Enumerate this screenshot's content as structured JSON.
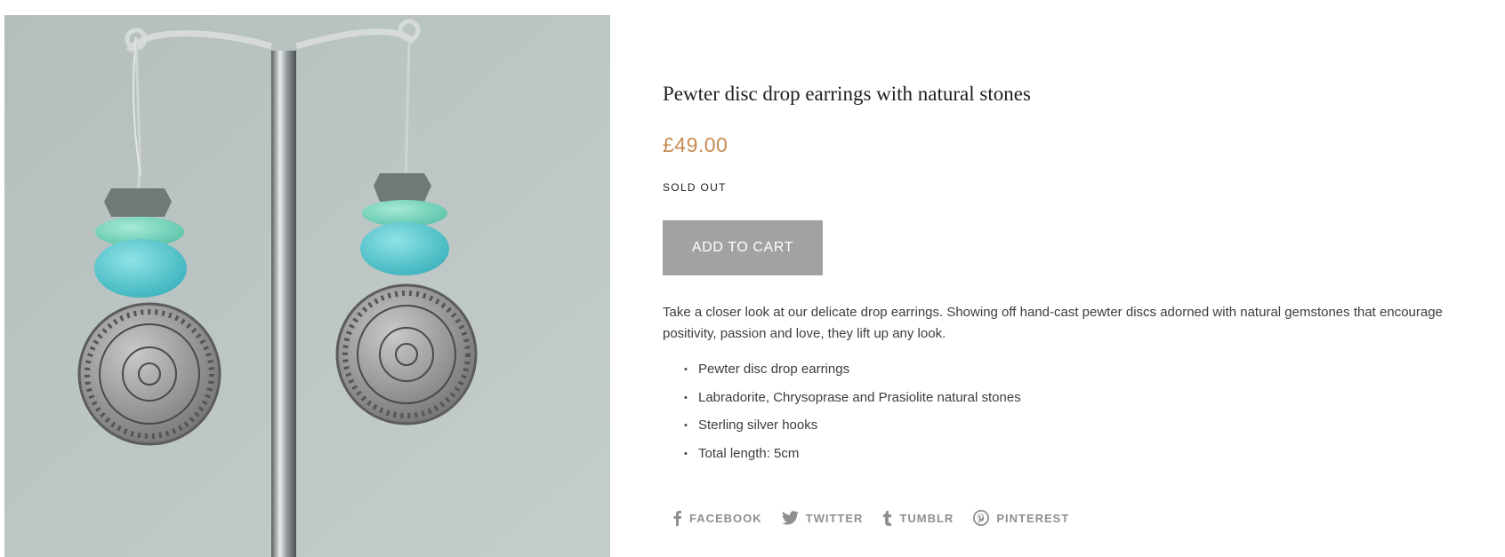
{
  "product": {
    "image_alt": "Pewter disc drop earrings with turquoise and labradorite stones on a metal stand",
    "title": "Pewter disc drop earrings with natural stones",
    "price": "£49.00",
    "availability": "SOLD OUT",
    "add_to_cart_label": "ADD TO CART",
    "description": "Take a closer look at our delicate drop earrings. Showing off hand-cast pewter discs adorned with natural gemstones that encourage positivity, passion and love, they lift up any look.",
    "features": [
      "Pewter disc drop earrings",
      "Labradorite, Chrysoprase and Prasiolite natural stones",
      "Sterling silver hooks",
      "Total length: 5cm"
    ]
  },
  "share": {
    "facebook": {
      "label": "FACEBOOK",
      "icon": "facebook-icon"
    },
    "twitter": {
      "label": "TWITTER",
      "icon": "twitter-icon"
    },
    "tumblr": {
      "label": "TUMBLR",
      "icon": "tumblr-icon"
    },
    "pinterest": {
      "label": "PINTEREST",
      "icon": "pinterest-icon"
    }
  },
  "colors": {
    "price": "#c78b52",
    "button_bg": "#a2a2a2",
    "share_text": "#8f8f8f",
    "image_bg": "#b9c3c1"
  }
}
